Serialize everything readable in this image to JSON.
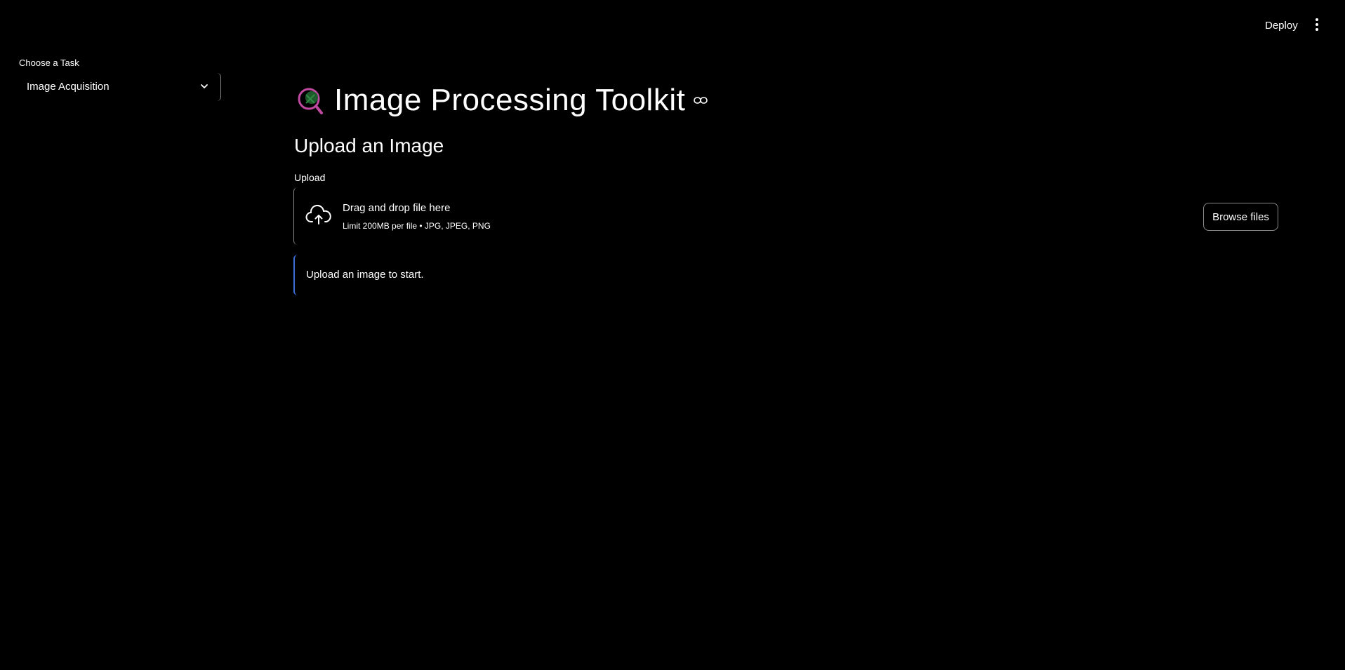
{
  "header": {
    "deploy_label": "Deploy",
    "menu_icon": "more-vertical-icon"
  },
  "sidebar": {
    "task_label": "Choose a Task",
    "task_selected": "Image Acquisition",
    "task_chevron_icon": "chevron-down-icon"
  },
  "main": {
    "title_icon": "microscope-emoji-icon",
    "title": "Image Processing Toolkit",
    "title_link_icon": "link-icon",
    "section_heading": "Upload an Image",
    "uploader": {
      "label": "Upload",
      "icon": "cloud-upload-icon",
      "drop_text": "Drag and drop file here",
      "limit_text": "Limit 200MB per file • JPG, JPEG, PNG",
      "browse_label": "Browse files"
    },
    "info_message": "Upload an image to start."
  },
  "colors": {
    "background": "#000000",
    "text": "#ffffff",
    "border": "#8a8a8a",
    "info_accent": "#3a6fd8"
  }
}
